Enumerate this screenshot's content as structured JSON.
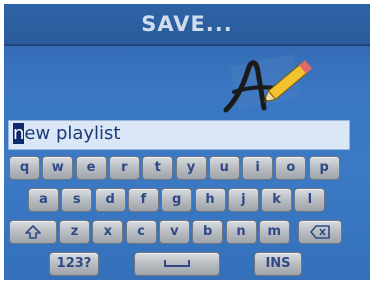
{
  "window": {
    "title": "SAVE..."
  },
  "logo": {
    "icon": "pencil-writing-icon"
  },
  "input": {
    "cursor_char": "n",
    "rest": "ew playlist"
  },
  "keyboard": {
    "row1": [
      "q",
      "w",
      "e",
      "r",
      "t",
      "y",
      "u",
      "i",
      "o",
      "p"
    ],
    "row2": [
      "a",
      "s",
      "d",
      "f",
      "g",
      "h",
      "j",
      "k",
      "l"
    ],
    "row3": [
      "z",
      "x",
      "c",
      "v",
      "b",
      "n",
      "m"
    ],
    "shift_icon": "shift-icon",
    "backspace_icon": "backspace-icon",
    "space_icon": "space-bar-icon",
    "numbers_label": "123?",
    "ins_label": "INS"
  },
  "colors": {
    "background": "#3a76c2",
    "title_text": "#cfdcec",
    "key_text": "#2f4a86"
  }
}
